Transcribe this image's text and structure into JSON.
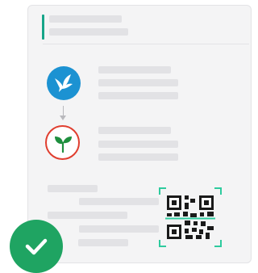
{
  "illustration": {
    "steps": [
      {
        "icon": "bird-icon",
        "color": "#1c92d2"
      },
      {
        "icon": "sprout-icon",
        "color": "#e03e2f"
      }
    ],
    "accent_color": "#17a589",
    "qr_scan_color": "#2ecb9e",
    "success_badge": {
      "icon": "checkmark-icon",
      "color": "#1fa462"
    }
  }
}
